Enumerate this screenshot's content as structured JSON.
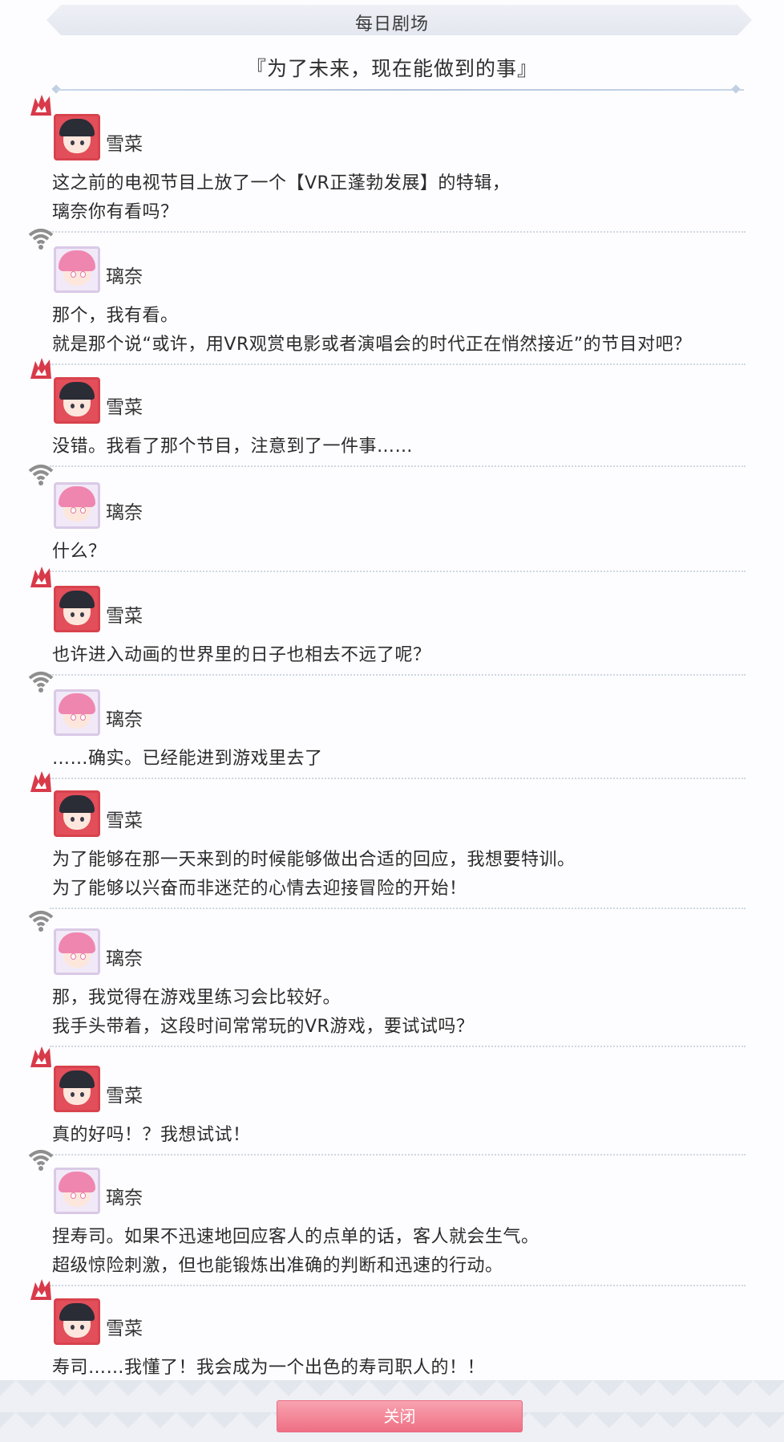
{
  "header": {
    "title": "每日剧场"
  },
  "story": {
    "title": "『为了未来，现在能做到的事』"
  },
  "dialogue": [
    {
      "speaker": "雪菜",
      "lines": [
        "这之前的电视节目上放了一个【VR正蓬勃发展】的特辑，",
        "璃奈你有看吗？"
      ]
    },
    {
      "speaker": "璃奈",
      "lines": [
        "那个，我有看。",
        "就是那个说“或许，用VR观赏电影或者演唱会的时代正在悄然接近”的节目对吧？"
      ]
    },
    {
      "speaker": "雪菜",
      "lines": [
        "没错。我看了那个节目，注意到了一件事……"
      ]
    },
    {
      "speaker": "璃奈",
      "lines": [
        "什么？"
      ]
    },
    {
      "speaker": "雪菜",
      "lines": [
        "也许进入动画的世界里的日子也相去不远了呢？"
      ]
    },
    {
      "speaker": "璃奈",
      "lines": [
        "……确实。已经能进到游戏里去了"
      ]
    },
    {
      "speaker": "雪菜",
      "lines": [
        "为了能够在那一天来到的时候能够做出合适的回应，我想要特训。",
        "为了能够以兴奋而非迷茫的心情去迎接冒险的开始！"
      ]
    },
    {
      "speaker": "璃奈",
      "lines": [
        "那，我觉得在游戏里练习会比较好。",
        "我手头带着，这段时间常常玩的VR游戏，要试试吗？"
      ]
    },
    {
      "speaker": "雪菜",
      "lines": [
        "真的好吗！？我想试试！"
      ]
    },
    {
      "speaker": "璃奈",
      "lines": [
        "捏寿司。如果不迅速地回应客人的点单的话，客人就会生气。",
        "超级惊险刺激，但也能锻炼出准确的判断和迅速的行动。"
      ]
    },
    {
      "speaker": "雪菜",
      "lines": [
        "寿司……我懂了！我会成为一个出色的寿司职人的！！"
      ]
    }
  ],
  "footer": {
    "close_label": "关闭"
  },
  "colors": {
    "accent": "#ee6f84",
    "setsuna_badge": "#d83a4a",
    "rina_badge": "#8e8e8e"
  }
}
